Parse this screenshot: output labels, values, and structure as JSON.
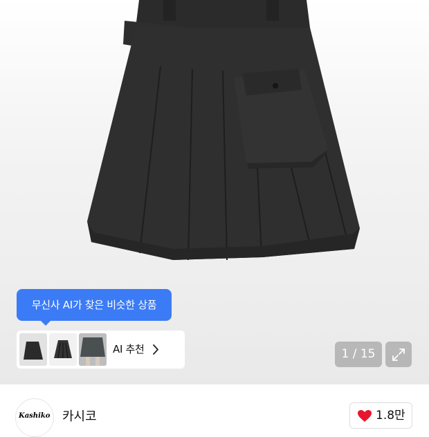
{
  "ai_recommend": {
    "tooltip": "무신사 AI가 찾은 비슷한 상품",
    "label": "AI 추천"
  },
  "gallery": {
    "counter": "1 / 15"
  },
  "brand": {
    "logo_text": "Kashiko",
    "name": "카시코"
  },
  "like": {
    "count": "1.8만"
  },
  "colors": {
    "accent_blue": "#3b7bf6",
    "like_red": "#e8152b"
  },
  "icons": [
    "chevron-right-icon",
    "expand-icon",
    "heart-icon"
  ]
}
